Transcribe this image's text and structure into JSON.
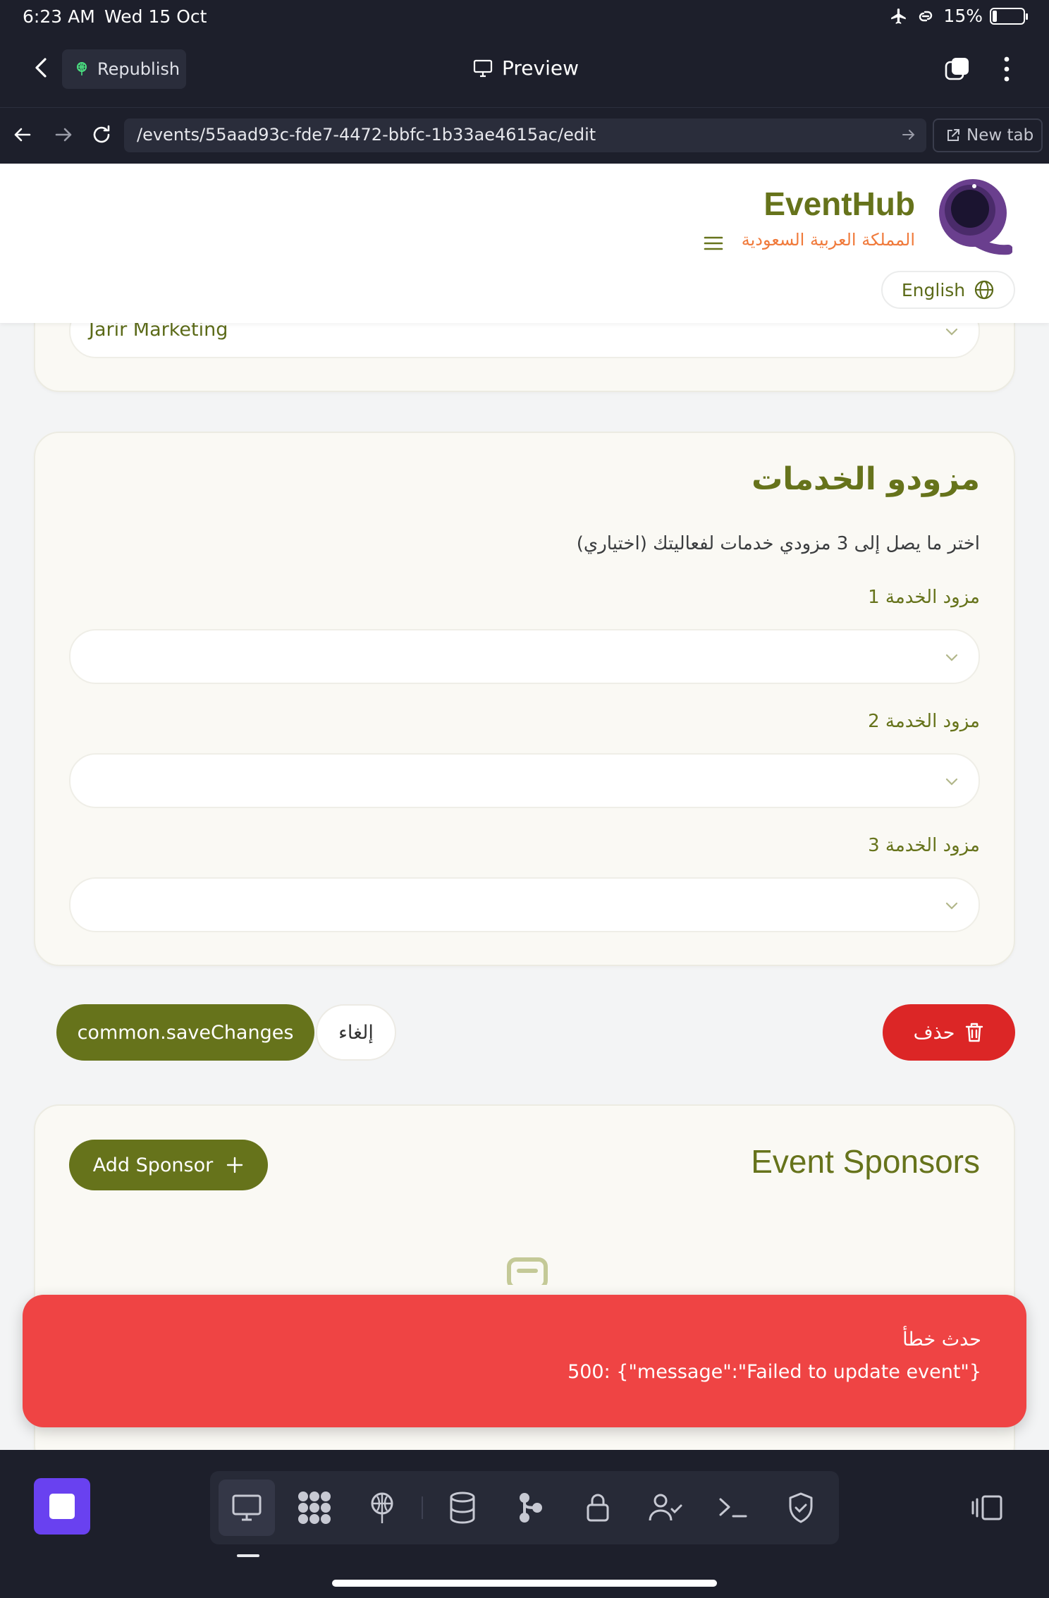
{
  "status_bar": {
    "time": "6:23 AM",
    "date": "Wed 15 Oct",
    "battery": "15%",
    "battery_level": 0.15
  },
  "toolbar": {
    "republish_label": "Republish",
    "preview_label": "Preview"
  },
  "browser": {
    "url": "/events/55aad93c-fde7-4472-bbfc-1b33ae4615ac/edit",
    "new_tab_label": "New tab"
  },
  "header": {
    "brand_name": "EventHub",
    "brand_subtitle": "المملكة العربية السعودية",
    "language_label": "English"
  },
  "previous_section": {
    "selected_value": "Jarir Marketing"
  },
  "service_providers": {
    "title": "مزودو الخدمات",
    "description": "اختر ما يصل إلى 3 مزودي خدمات لفعاليتك (اختياري)",
    "fields": [
      {
        "label": "مزود الخدمة 1",
        "value": ""
      },
      {
        "label": "مزود الخدمة 2",
        "value": ""
      },
      {
        "label": "مزود الخدمة 3",
        "value": ""
      }
    ]
  },
  "actions": {
    "save_label": "common.saveChanges",
    "cancel_label": "إلغاء",
    "delete_label": "حذف"
  },
  "sponsors": {
    "title": "Event Sponsors",
    "add_label": "Add Sponsor"
  },
  "toast": {
    "title": "حدث خطأ",
    "message": "500: {\"message\":\"Failed to update event\"}"
  },
  "dock": {
    "items": [
      "preview-icon",
      "apps-grid-icon",
      "deploy-icon",
      "database-icon",
      "git-icon",
      "secrets-lock-icon",
      "user-auth-icon",
      "shell-icon",
      "security-shield-icon"
    ],
    "active": "preview-icon"
  },
  "colors": {
    "brand_olive": "#66731b",
    "brand_orange": "#f07a3b",
    "danger": "#dc2626",
    "toast_red": "#ef4444",
    "replit_purple": "#6941f0"
  }
}
